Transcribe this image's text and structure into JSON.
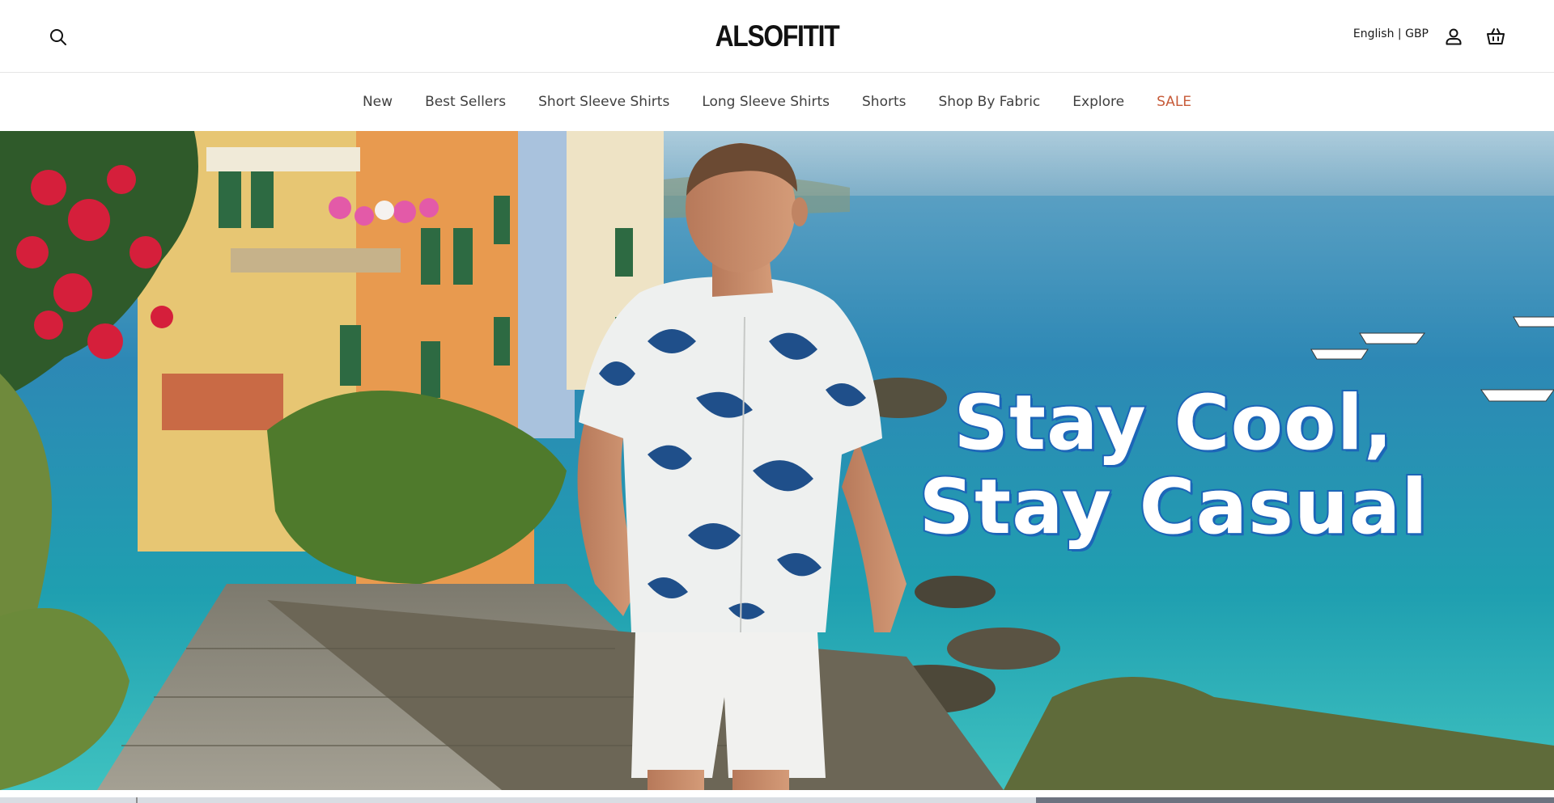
{
  "header": {
    "logo": "ALSOFITIT",
    "locale": "English | GBP",
    "icons": {
      "search": "search-icon",
      "account": "user-icon",
      "cart": "basket-icon"
    }
  },
  "nav": {
    "items": [
      {
        "label": "New"
      },
      {
        "label": "Best Sellers"
      },
      {
        "label": "Short Sleeve Shirts"
      },
      {
        "label": "Long Sleeve Shirts"
      },
      {
        "label": "Shorts"
      },
      {
        "label": "Shop By Fabric"
      },
      {
        "label": "Explore"
      },
      {
        "label": "SALE"
      }
    ],
    "sale_color": "#c75b39"
  },
  "hero": {
    "headline_line1": "Stay Cool,",
    "headline_line2": "Stay Casual",
    "headline_outline_color": "#1d66b8"
  }
}
